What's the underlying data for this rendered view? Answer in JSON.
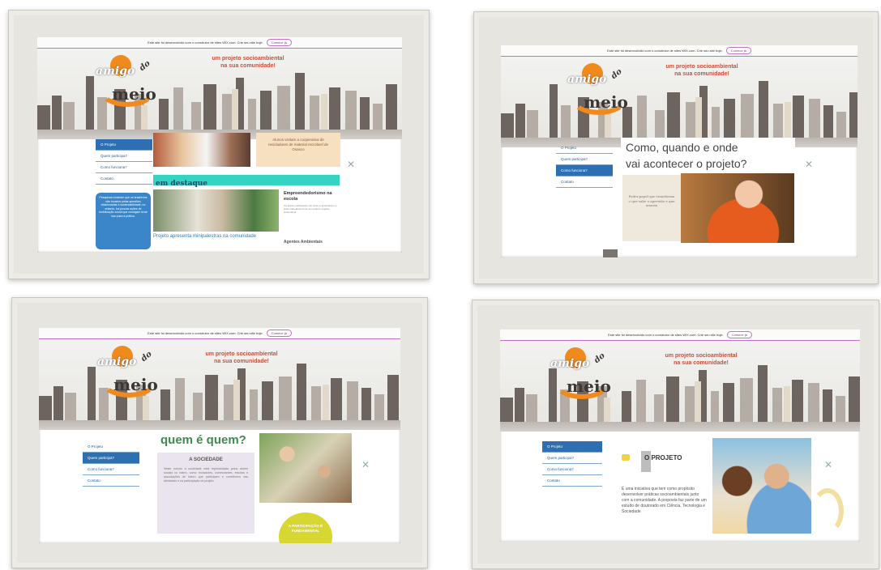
{
  "wix_bar": {
    "notice": "Este site foi desenvolvido com o construtor de sites WIX.com. Crie seu site hoje.",
    "button": "Comece já"
  },
  "header": {
    "logo_amigo": "amigo",
    "logo_do": "do",
    "logo_meio": "meio",
    "tagline_line1": "um projeto socioambiental",
    "tagline_line2": "na sua comunidade!"
  },
  "nav": [
    "O Projeto",
    "Quem participa?",
    "Como funciona?",
    "Contato"
  ],
  "colors": {
    "accent_orange": "#f08a1c",
    "nav_blue": "#2d6fb0",
    "teal": "#34d3c2",
    "wix_purple": "#c56fc8"
  },
  "screens": [
    {
      "banner_text": "Alunos visitam a cooperativa de recicladores de material reciclável de Osasco",
      "section_title": "em destaque",
      "news_title": "Empreendedorismo na escola",
      "news_body": "Os alunos participaram do curso e aprenderam a fazer planejamento do seu próprio negócio sustentável.",
      "caption": "Projeto apresenta minipalestras na comunidade",
      "news2_title": "Agentes Ambientais",
      "sidebar_box": "Pesquisas mostram que os brasileiros são tocados pelas questões relacionadas à sustentabilidade, no entanto, há poucas ações de mobilização social que consigam levar isso para a prática."
    },
    {
      "title_line1": "Como, quando e onde",
      "title_line2": "vai acontecer o projeto?",
      "quote": "Pedra-papel que transforma o que sabe o aprendiz e que amaria"
    },
    {
      "title": "quem é quem?",
      "box_title": "A SOCIEDADE",
      "box_body": "Neste estudo a sociedade está representada pelos atores sociais no bairro, como moradores, comerciantes, escolas e associações de bairro que participam e contribuem nas atividades e na participação do projeto.",
      "badge": "A PARTICIPAÇÃO É FUNDAMENTAL"
    },
    {
      "title": "O PROJETO",
      "body": "É uma iniciativa que tem como propósito desenvolver práticas socioambientais junto com a comunidade. A proposta faz parte de um estudo de doutorado em Ciência, Tecnologia e Sociedade"
    }
  ]
}
